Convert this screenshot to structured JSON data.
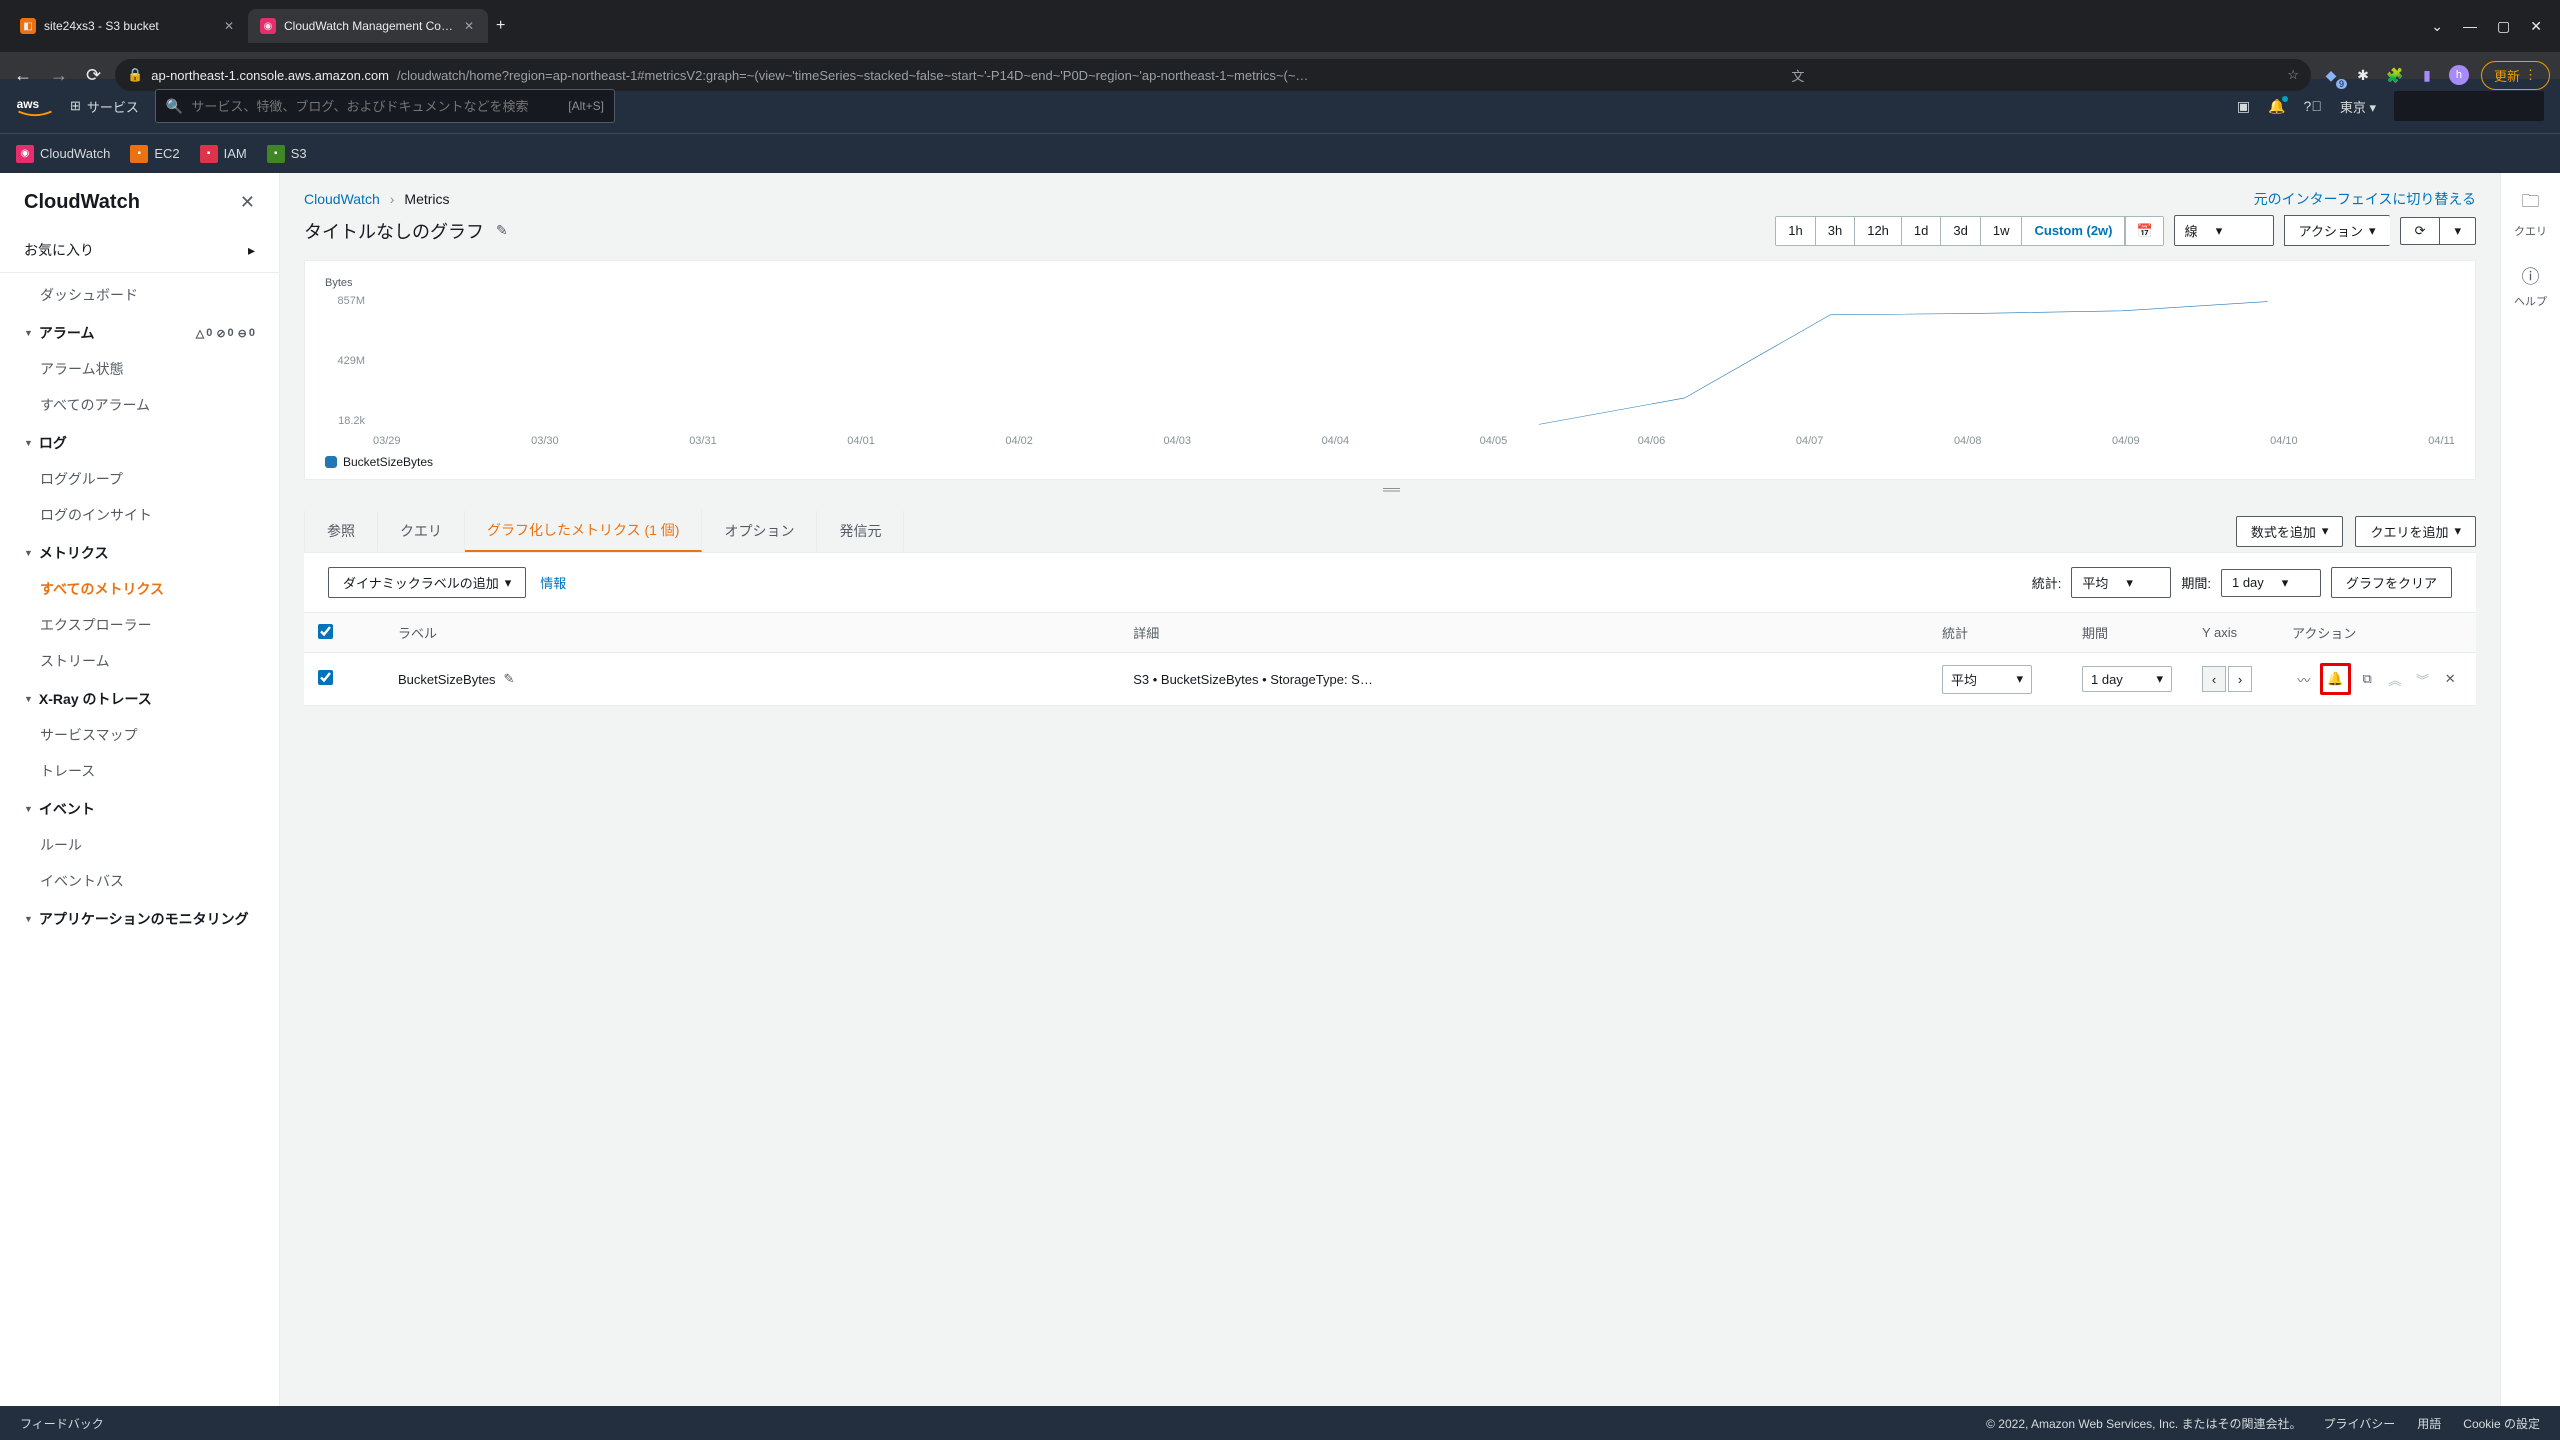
{
  "browser": {
    "tabs": [
      {
        "title": "site24xs3 - S3 bucket",
        "favicon_color": "#ec7211"
      },
      {
        "title": "CloudWatch Management Conso",
        "favicon_color": "#e52e6b"
      }
    ],
    "url_domain": "ap-northeast-1.console.aws.amazon.com",
    "url_path": "/cloudwatch/home?region=ap-northeast-1#metricsV2:graph=~(view~'timeSeries~stacked~false~start~'-P14D~end~'P0D~region~'ap-northeast-1~metrics~(~…",
    "update_label": "更新",
    "ext_badge": "9"
  },
  "aws_header": {
    "services_label": "サービス",
    "search_placeholder": "サービス、特徴、ブログ、およびドキュメントなどを検索",
    "search_shortcut": "[Alt+S]",
    "region": "東京"
  },
  "service_nav": [
    {
      "name": "CloudWatch",
      "color": "#e52e6b"
    },
    {
      "name": "EC2",
      "color": "#ec7211"
    },
    {
      "name": "IAM",
      "color": "#dd344c"
    },
    {
      "name": "S3",
      "color": "#3f8624"
    }
  ],
  "sidebar": {
    "title": "CloudWatch",
    "favorites": "お気に入り",
    "dashboard": "ダッシュボード",
    "alarms": {
      "label": "アラーム",
      "alarm_count": "0",
      "ok_count": "0",
      "insufficient_count": "0"
    },
    "alarm_state": "アラーム状態",
    "all_alarms": "すべてのアラーム",
    "logs": "ログ",
    "log_groups": "ロググループ",
    "log_insights": "ログのインサイト",
    "metrics": "メトリクス",
    "all_metrics": "すべてのメトリクス",
    "explorer": "エクスプローラー",
    "streams": "ストリーム",
    "xray": "X-Ray のトレース",
    "service_map": "サービスマップ",
    "traces": "トレース",
    "events": "イベント",
    "rules": "ルール",
    "event_bus": "イベントバス",
    "app_monitoring": "アプリケーションのモニタリング"
  },
  "breadcrumb": {
    "root": "CloudWatch",
    "current": "Metrics"
  },
  "old_ui_link": "元のインターフェイスに切り替える",
  "graph_title": "タイトルなしのグラフ",
  "time_ranges": [
    "1h",
    "3h",
    "12h",
    "1d",
    "3d",
    "1w"
  ],
  "time_custom": "Custom (2w)",
  "line_type": "線",
  "actions_btn": "アクション",
  "chart_data": {
    "type": "line",
    "ylabel": "Bytes",
    "y_ticks": [
      "857M",
      "429M",
      "18.2k"
    ],
    "x_ticks": [
      "03/29",
      "03/30",
      "03/31",
      "04/01",
      "04/02",
      "04/03",
      "04/04",
      "04/05",
      "04/06",
      "04/07",
      "04/08",
      "04/09",
      "04/10",
      "04/11"
    ],
    "series": [
      {
        "name": "BucketSizeBytes",
        "color": "#1f77b4"
      }
    ],
    "points_norm": [
      [
        0.56,
        0.98
      ],
      [
        0.63,
        0.78
      ],
      [
        0.7,
        0.15
      ],
      [
        0.77,
        0.14
      ],
      [
        0.84,
        0.12
      ],
      [
        0.91,
        0.05
      ]
    ]
  },
  "tabs": {
    "browse": "参照",
    "query": "クエリ",
    "graphed": "グラフ化したメトリクス (1 個)",
    "options": "オプション",
    "source": "発信元",
    "add_math": "数式を追加",
    "add_query": "クエリを追加"
  },
  "filter_row": {
    "dynamic_label": "ダイナミックラベルの追加",
    "info": "情報",
    "stat_label": "統計:",
    "stat_value": "平均",
    "period_label": "期間:",
    "period_value": "1 day",
    "clear_graph": "グラフをクリア"
  },
  "table": {
    "headers": {
      "label": "ラベル",
      "detail": "詳細",
      "stat": "統計",
      "period": "期間",
      "yaxis": "Y axis",
      "actions": "アクション"
    },
    "rows": [
      {
        "label": "BucketSizeBytes",
        "detail": "S3 • BucketSizeBytes • StorageType: S…",
        "stat": "平均",
        "period": "1 day"
      }
    ]
  },
  "right_tools": {
    "query": "クエリ",
    "help": "ヘルプ"
  },
  "footer": {
    "feedback": "フィードバック",
    "copyright": "© 2022, Amazon Web Services, Inc. またはその関連会社。",
    "privacy": "プライバシー",
    "terms": "用語",
    "cookie": "Cookie の設定"
  }
}
